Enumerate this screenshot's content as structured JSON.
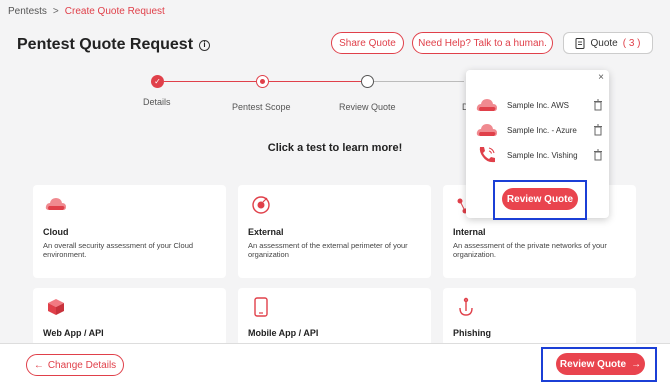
{
  "breadcrumb": {
    "root": "Pentests",
    "separator": ">",
    "current": "Create Quote Request"
  },
  "page": {
    "title": "Pentest Quote Request",
    "info_icon": "i"
  },
  "header_buttons": {
    "share": "Share Quote",
    "help": "Need Help? Talk to a human.",
    "quote_label": "Quote",
    "quote_count": "( 3 )"
  },
  "stepper": {
    "steps": [
      {
        "label": "Details",
        "state": "done"
      },
      {
        "label": "Pentest Scope",
        "state": "active"
      },
      {
        "label": "Review Quote",
        "state": "todo"
      },
      {
        "label": "D",
        "state": "todo"
      }
    ]
  },
  "hint": "Click a test to learn more!",
  "cards": [
    {
      "title": "Cloud",
      "desc": "An overall security assessment of your Cloud environment.",
      "icon": "cloud-icon"
    },
    {
      "title": "External",
      "desc": "An assessment of the external perimeter of your organization",
      "icon": "target-icon"
    },
    {
      "title": "Internal",
      "desc": "An assessment of the private networks of your organization.",
      "icon": "network-icon"
    },
    {
      "title": "Web App / API",
      "desc": "",
      "icon": "cube-icon"
    },
    {
      "title": "Mobile App / API",
      "desc": "",
      "icon": "mobile-icon"
    },
    {
      "title": "Phishing",
      "desc": "",
      "icon": "hook-icon"
    }
  ],
  "popover": {
    "close": "×",
    "items": [
      {
        "label": "Sample Inc. AWS",
        "icon": "cloud-icon"
      },
      {
        "label": "Sample Inc. - Azure",
        "icon": "cloud-icon"
      },
      {
        "label": "Sample Inc. Vishing",
        "icon": "phone-icon"
      }
    ],
    "review_button": "Review Quote"
  },
  "footer": {
    "back": "Change Details",
    "back_arrow": "←",
    "review": "Review Quote",
    "review_arrow": "→"
  },
  "colors": {
    "accent": "#e0404a",
    "highlight": "#1b3fd6",
    "background": "#f4f4f5"
  }
}
